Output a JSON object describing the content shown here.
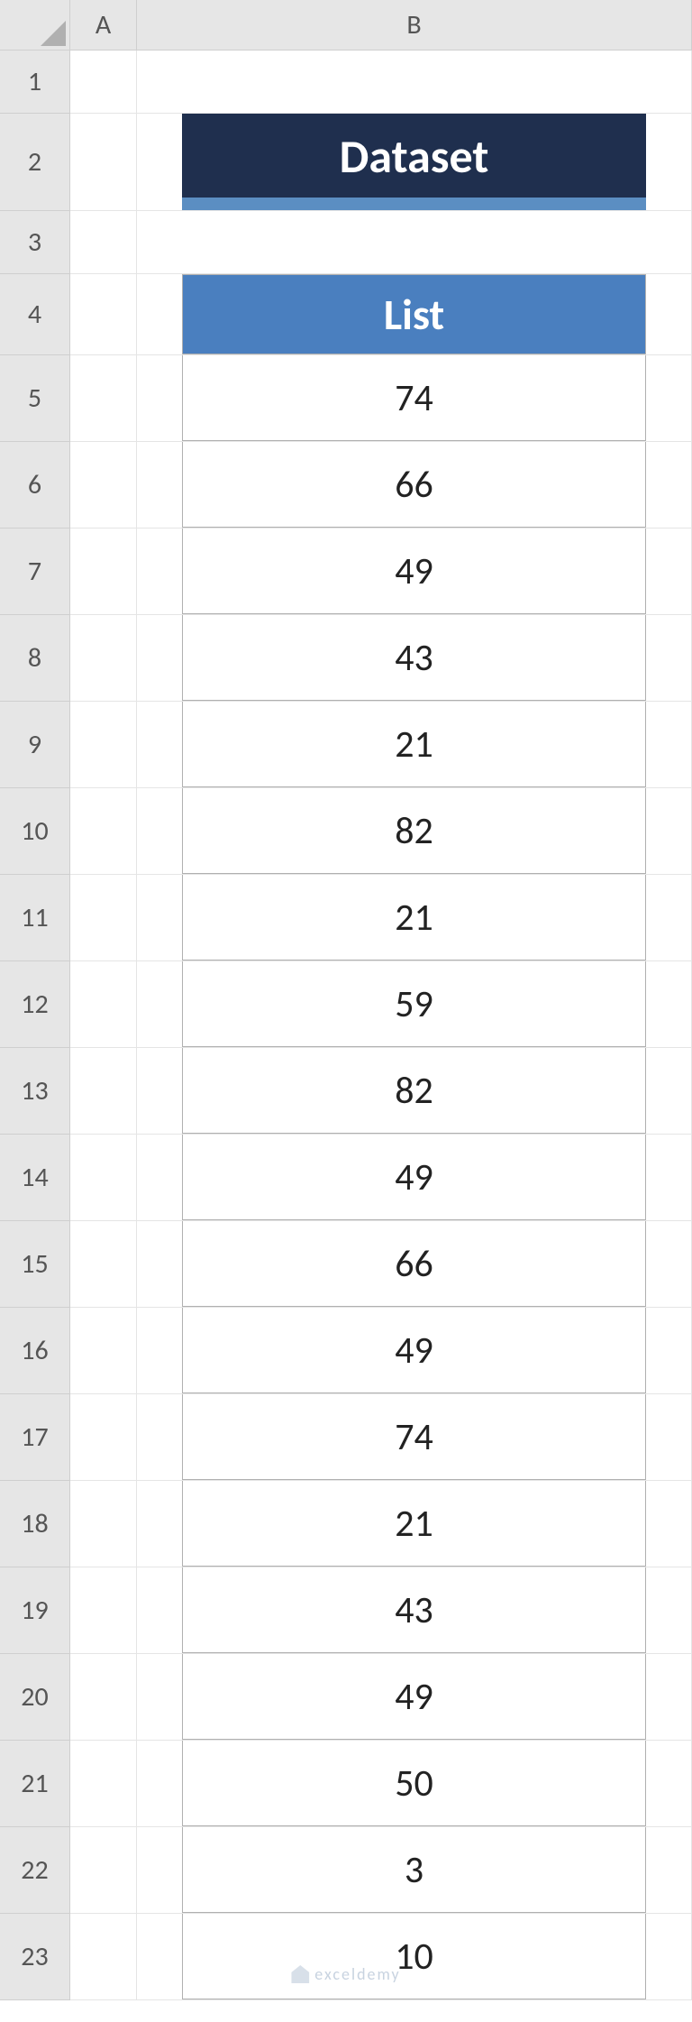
{
  "columns": [
    "A",
    "B"
  ],
  "row_numbers": [
    1,
    2,
    3,
    4,
    5,
    6,
    7,
    8,
    9,
    10,
    11,
    12,
    13,
    14,
    15,
    16,
    17,
    18,
    19,
    20,
    21,
    22,
    23
  ],
  "title": "Dataset",
  "list_header": "List",
  "data": [
    74,
    66,
    49,
    43,
    21,
    82,
    21,
    59,
    82,
    49,
    66,
    49,
    74,
    21,
    43,
    49,
    50,
    3,
    10
  ],
  "watermark": "exceldemy",
  "chart_data": {
    "type": "table",
    "title": "Dataset",
    "columns": [
      "List"
    ],
    "values": [
      74,
      66,
      49,
      43,
      21,
      82,
      21,
      59,
      82,
      49,
      66,
      49,
      74,
      21,
      43,
      49,
      50,
      3,
      10
    ]
  }
}
